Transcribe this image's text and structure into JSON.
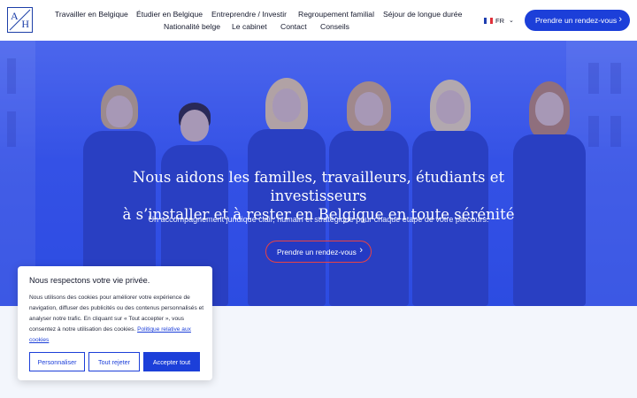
{
  "brand": {
    "logo_letters": [
      "A",
      "H"
    ]
  },
  "nav": {
    "row1": [
      "Travailler en Belgique",
      "Étudier en Belgique",
      "Entreprendre / Investir",
      "Regroupement familial",
      "Séjour de longue durée"
    ],
    "row2": [
      "Nationalité belge",
      "Le cabinet",
      "Contact",
      "Conseils"
    ]
  },
  "lang": {
    "current": "FR"
  },
  "header_cta": {
    "label": "Prendre un rendez-vous"
  },
  "hero": {
    "title_line1": "Nous aidons les familles, travailleurs, étudiants et investisseurs",
    "title_line2": "à s’installer et à rester en Belgique en toute sérénité",
    "subtitle": "Un accompagnement juridique clair, humain et stratégique pour chaque étape de votre parcours.",
    "cta_label": "Prendre un rendez-vous"
  },
  "cookie": {
    "title": "Nous respectons votre vie privée.",
    "body": "Nous utilisons des cookies pour améliorer votre expérience de navigation, diffuser des publicités ou des contenus personnalisés et analyser notre trafic. En cliquant sur « Tout accepter », vous consentez à notre utilisation des cookies.",
    "policy_link": "Politique relative aux cookies",
    "btn_customize": "Personnaliser",
    "btn_reject": "Tout rejeter",
    "btn_accept": "Accepter tout"
  },
  "colors": {
    "primary": "#1c3fd9",
    "hero_blue": "#3a57e6",
    "cta_border": "#e94343",
    "text_dark": "#15192d"
  }
}
